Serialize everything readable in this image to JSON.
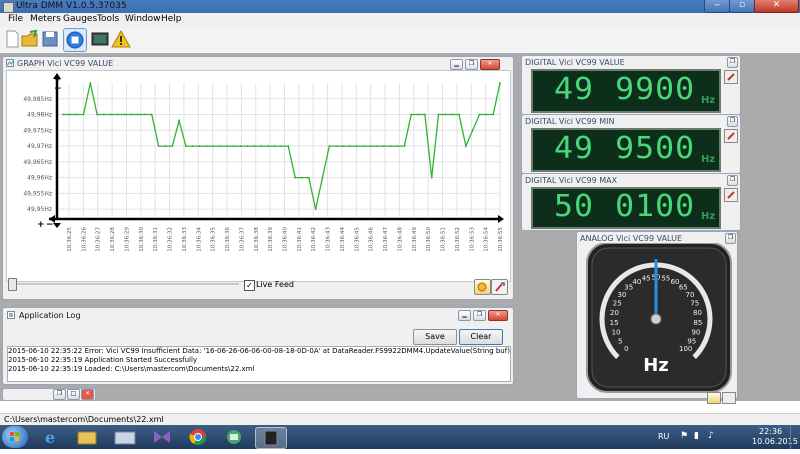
{
  "window": {
    "title": "Ultra DMM V1.0.5.37035"
  },
  "menu": [
    "File",
    "Meters",
    "Gauges",
    "Tools",
    "Window",
    "Help"
  ],
  "toolbar_icons": [
    "new-file-icon",
    "open-folder-icon",
    "save-disk-icon",
    "stop-record-icon",
    "monitor-icon",
    "warning-icon"
  ],
  "graph_panel": {
    "title": "GRAPH Vici VC99 VALUE",
    "live_feed_label": "Live Feed",
    "live_feed_checked": true,
    "chart_data": {
      "type": "line",
      "y_tick_labels": [
        "49,985Hz",
        "49,98Hz",
        "49,975Hz",
        "49,97Hz",
        "49,965Hz",
        "49,96Hz",
        "49,955Hz",
        "49,95Hz"
      ],
      "ylim": [
        49.9475,
        49.99
      ],
      "x_tick_labels": [
        "10:36:25",
        "10:36:26",
        "10:36:27",
        "10:36:28",
        "10:36:29",
        "10:36:30",
        "10:36:31",
        "10:36:32",
        "10:36:33",
        "10:36:34",
        "10:36:35",
        "10:36:36",
        "10:36:37",
        "10:36:38",
        "10:36:39",
        "10:36:40",
        "10:36:41",
        "10:36:42",
        "10:36:43",
        "10:36:44",
        "10:36:45",
        "10:36:46",
        "10:36:47",
        "10:36:48",
        "10:36:49",
        "10:36:50",
        "10:36:51",
        "10:36:52",
        "10:36:53",
        "10:36:54",
        "10:36:55"
      ],
      "series": [
        {
          "color": "#2eb52e",
          "values": [
            49.98,
            49.98,
            49.98,
            49.98,
            49.99,
            49.98,
            49.98,
            49.98,
            49.98,
            49.98,
            49.98,
            49.98,
            49.98,
            49.98,
            49.97,
            49.97,
            49.97,
            49.978,
            49.97,
            49.97,
            49.97,
            49.97,
            49.97,
            49.97,
            49.97,
            49.97,
            49.97,
            49.97,
            49.97,
            49.97,
            49.97,
            49.97,
            49.97,
            49.97,
            49.96,
            49.96,
            49.96,
            49.95,
            49.96,
            49.97,
            49.97,
            49.97,
            49.97,
            49.97,
            49.97,
            49.97,
            49.97,
            49.97,
            49.97,
            49.97,
            49.97,
            49.98,
            49.98,
            49.98,
            49.96,
            49.98,
            49.98,
            49.98,
            49.98,
            49.97,
            49.975,
            49.98,
            49.98,
            49.98,
            49.99
          ]
        }
      ],
      "grid": true
    }
  },
  "log_panel": {
    "title": "Application Log",
    "save_label": "Save",
    "clear_label": "Clear",
    "lines": [
      "2015-06-10 22:35:22  Error: Vici VC99 Insufficient Data: '16-06-26-06-06-00-08-18-0D-0A'     at DataReader.FS9922DMM4.UpdateValue(String buf)   at DataReader.DMMBase._Ses",
      "2015-06-10 22:35:19  Application Started Successfully",
      "2015-06-10 22:35:19  Loaded: C:\\Users\\mastercom\\Documents\\22.xml"
    ]
  },
  "digital_value": {
    "title": "DIGITAL Vici VC99 VALUE",
    "left": "49",
    "right": "9900",
    "unit": "Hz"
  },
  "digital_min": {
    "title": "DIGITAL Vici VC99 MIN",
    "left": "49",
    "right": "9500",
    "unit": "Hz"
  },
  "digital_max": {
    "title": "DIGITAL Vici VC99 MAX",
    "left": "50",
    "right": "0100",
    "unit": "Hz"
  },
  "analog": {
    "title": "ANALOG Vici VC99 VALUE",
    "unit": "Hz",
    "scale_labels": [
      "0",
      "5",
      "10",
      "15",
      "20",
      "25",
      "30",
      "35",
      "40",
      "45",
      "50",
      "55",
      "60",
      "65",
      "70",
      "75",
      "80",
      "85",
      "90",
      "95",
      "100"
    ],
    "needle_value": 50
  },
  "statusbar": {
    "path": "C:\\Users\\mastercom\\Documents\\22.xml"
  },
  "taskbar": {
    "language": "RU",
    "time": "22:36",
    "date": "10.06.2015"
  }
}
